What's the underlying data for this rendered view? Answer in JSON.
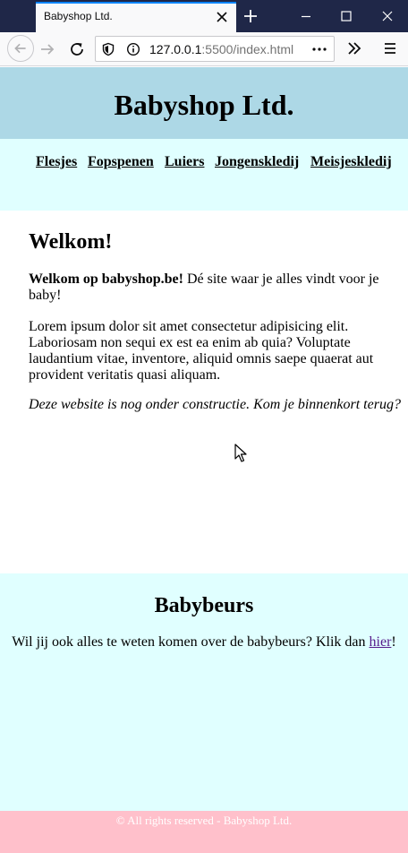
{
  "browser": {
    "tab_title": "Babyshop Ltd.",
    "url_host": "127.0.0.1",
    "url_rest": ":5500/index.html",
    "icons": [
      "close-icon",
      "plus-icon",
      "minimize-icon",
      "maximize-icon",
      "close-window-icon",
      "back-icon",
      "forward-icon",
      "reload-icon",
      "shield-icon",
      "info-icon",
      "more-icon",
      "overflow-icon",
      "menu-icon"
    ],
    "colors": {
      "tabbar": "#1f2748",
      "accent": "#0a84ff",
      "toolbar": "#f9f9fa"
    }
  },
  "site": {
    "title": "Babyshop Ltd.",
    "nav": [
      "Flesjes",
      "Fopspenen",
      "Luiers",
      "Jongenskledij",
      "Meisjeskledij"
    ],
    "welcome": {
      "heading": "Welkom!",
      "intro_bold": "Welkom op babyshop.be!",
      "intro_rest": " Dé site waar je alles vindt voor je baby!",
      "lorem": "Lorem ipsum dolor sit amet consectetur adipisicing elit. Laboriosam non sequi ex est ea enim ab quia? Voluptate laudantium vitae, inventore, aliquid omnis saepe quaerat aut provident veritatis quasi aliquam.",
      "notice": "Deze website is nog onder constructie. Kom je binnenkort terug?"
    },
    "babybeurs": {
      "heading": "Babybeurs",
      "text_before": "Wil jij ook alles te weten komen over de babybeurs? Klik dan ",
      "link_text": "hier",
      "text_after": "!"
    },
    "footer": "© All rights reserved - Babyshop Ltd.",
    "colors": {
      "header": "#add8e6",
      "nav": "#e0ffff",
      "babybeurs": "#e0ffff",
      "footer": "#ffc0cb",
      "link_visited": "#551a8b"
    }
  }
}
